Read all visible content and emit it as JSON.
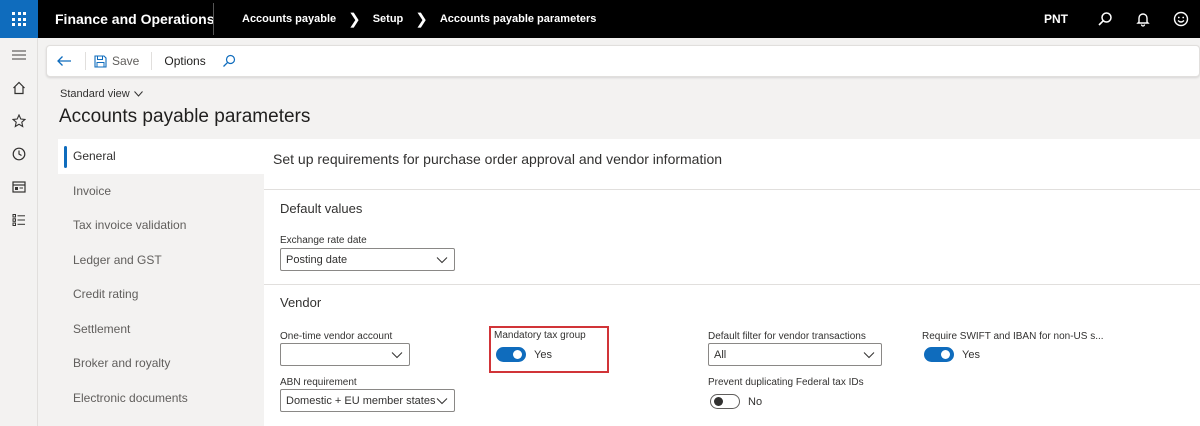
{
  "topbar": {
    "app_title": "Finance and Operations",
    "breadcrumb": [
      "Accounts payable",
      "Setup",
      "Accounts payable parameters"
    ],
    "company": "PNT",
    "icons": [
      "waffle-icon",
      "search-icon",
      "bell-icon",
      "smiley-icon"
    ]
  },
  "rail": {
    "icons": [
      "hamburger-icon",
      "home-icon",
      "star-icon",
      "clock-icon",
      "workspace-icon",
      "list-icon"
    ]
  },
  "actionpane": {
    "save_label": "Save",
    "options_label": "Options"
  },
  "page": {
    "view": "Standard view",
    "title": "Accounts payable parameters"
  },
  "tabs": [
    {
      "label": "General",
      "active": true
    },
    {
      "label": "Invoice"
    },
    {
      "label": "Tax invoice validation"
    },
    {
      "label": "Ledger and GST"
    },
    {
      "label": "Credit rating"
    },
    {
      "label": "Settlement"
    },
    {
      "label": "Broker and royalty"
    },
    {
      "label": "Electronic documents"
    }
  ],
  "content": {
    "heading": "Set up requirements for purchase order approval and vendor information",
    "default_values": {
      "title": "Default values",
      "exchange_rate_date_label": "Exchange rate date",
      "exchange_rate_date_value": "Posting date"
    },
    "vendor": {
      "title": "Vendor",
      "one_time_vendor_label": "One-time vendor account",
      "one_time_vendor_value": "",
      "abn_label": "ABN requirement",
      "abn_value": "Domestic + EU member states",
      "mandatory_tax_group_label": "Mandatory tax group",
      "mandatory_tax_group_value": "Yes",
      "default_filter_label": "Default filter for vendor transactions",
      "default_filter_value": "All",
      "prevent_dup_label": "Prevent duplicating Federal tax IDs",
      "prevent_dup_value": "No",
      "swift_label": "Require SWIFT and IBAN for non-US s...",
      "swift_value": "Yes"
    }
  },
  "colors": {
    "accent": "#0f6cbd",
    "highlight": "#d13438"
  }
}
